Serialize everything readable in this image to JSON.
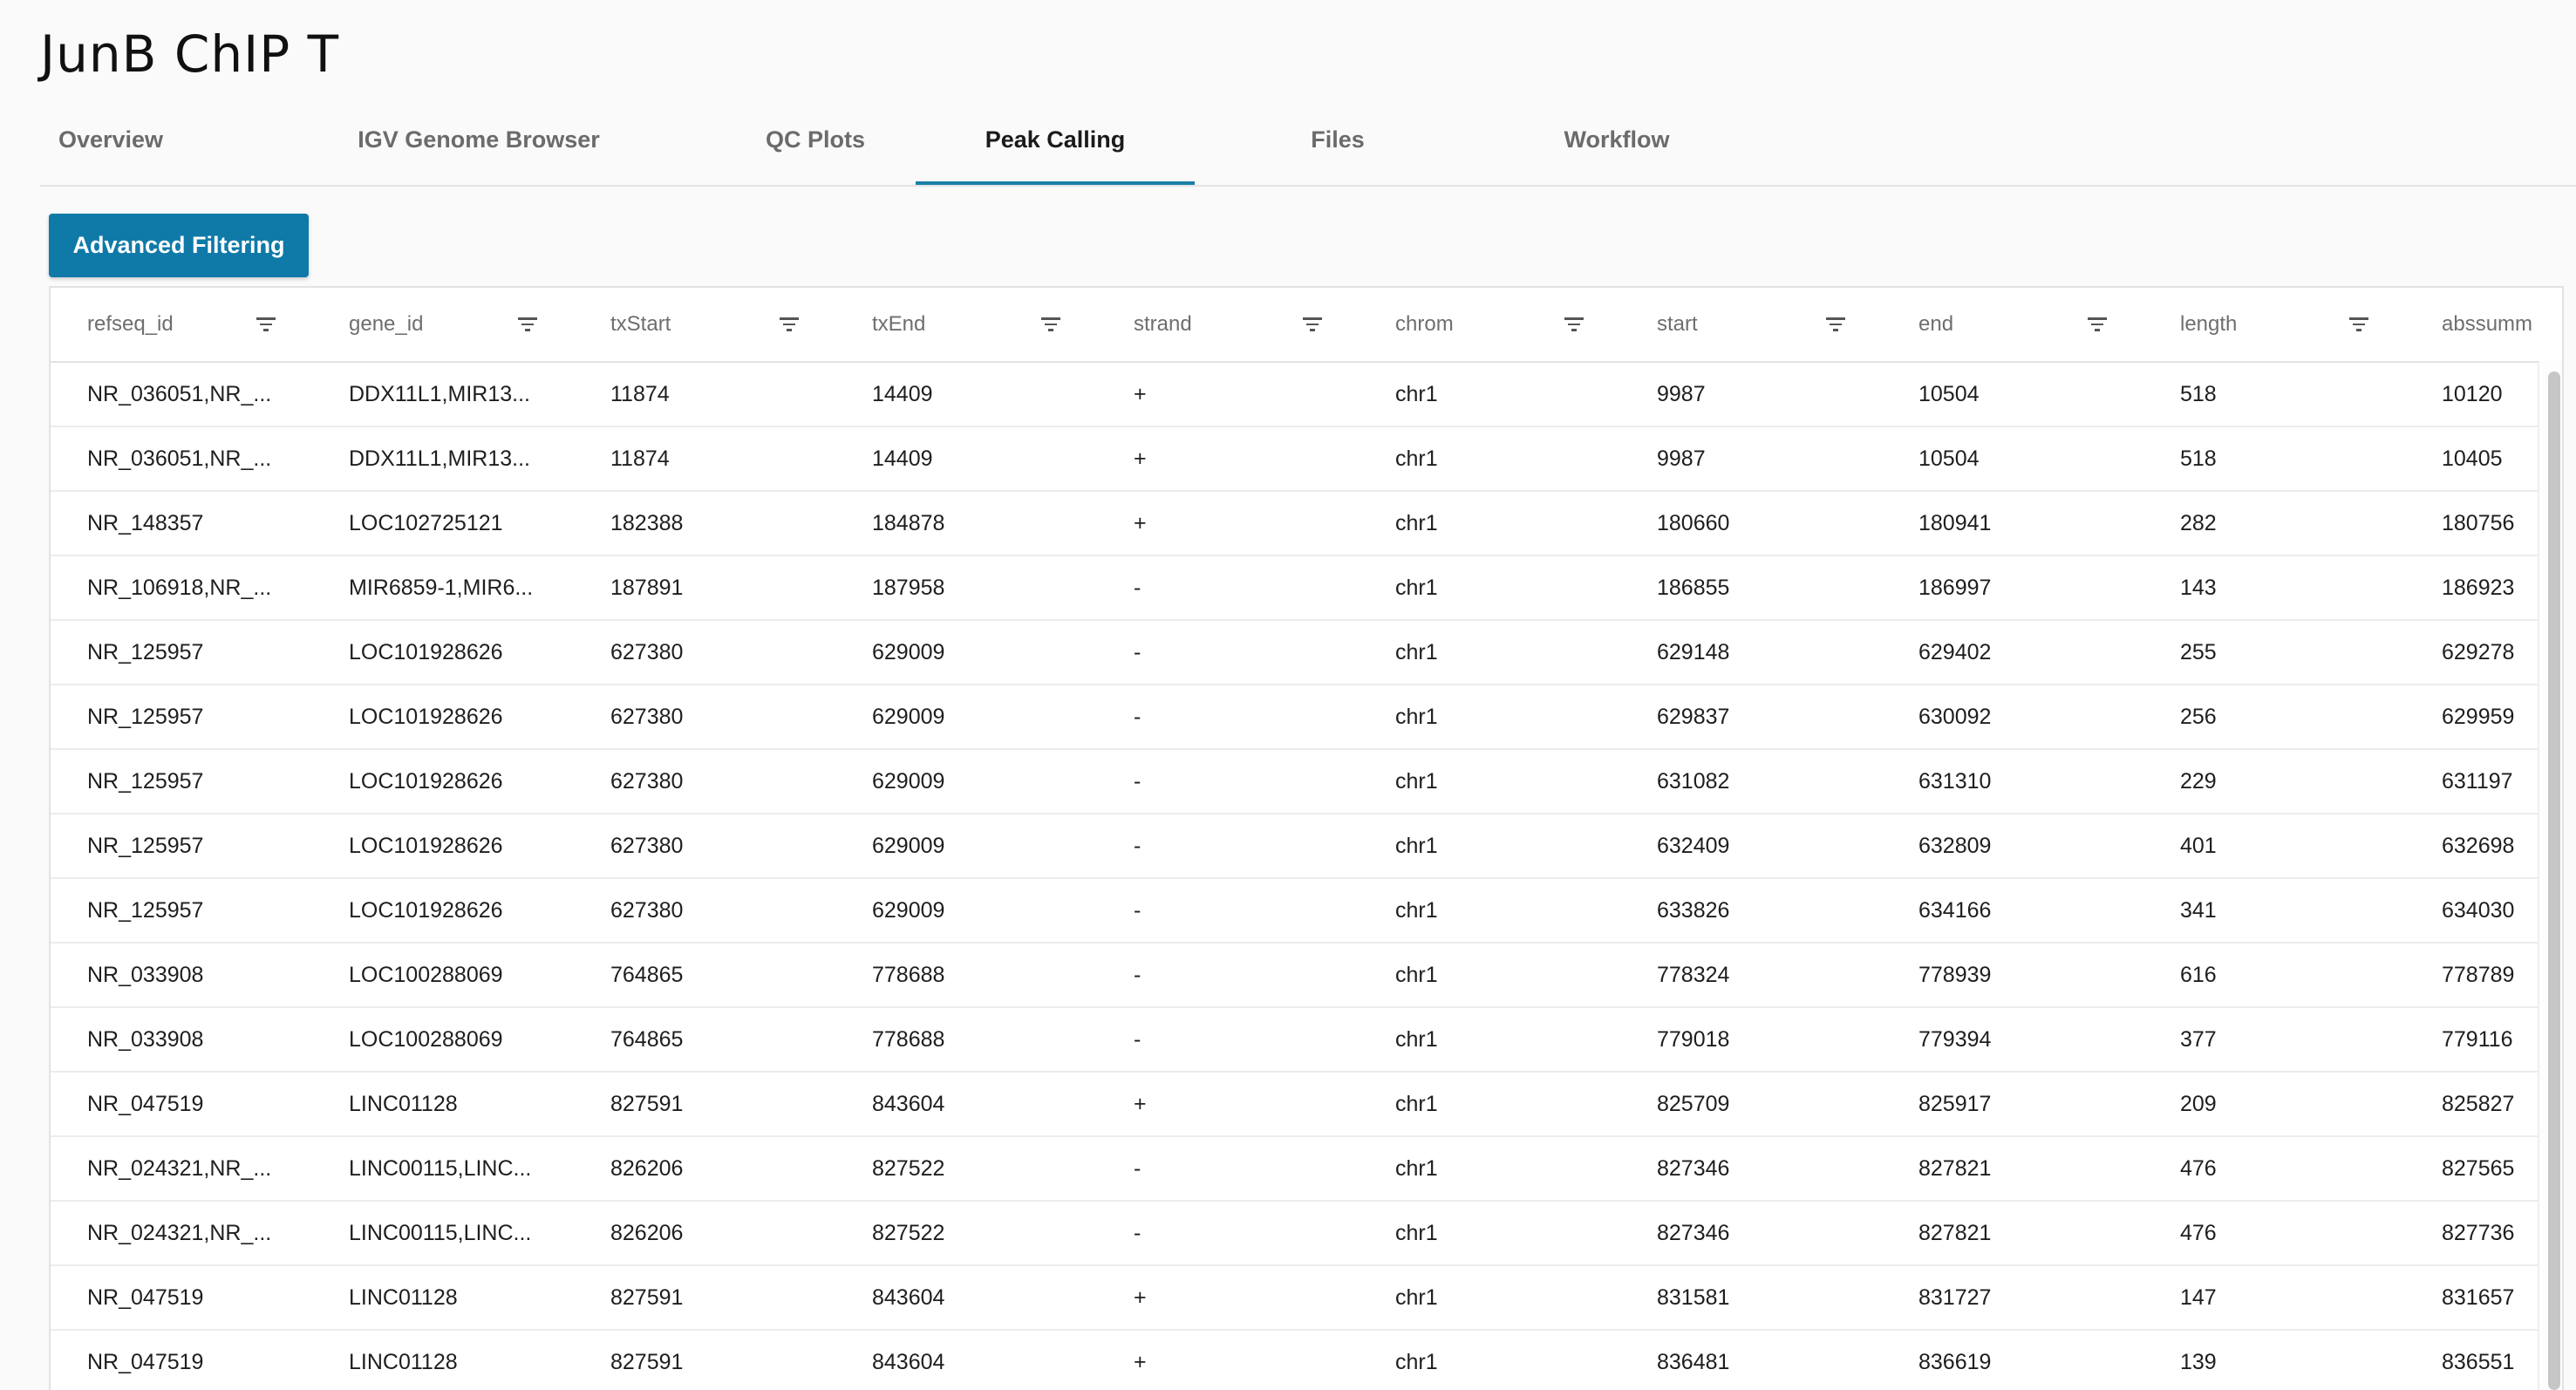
{
  "title": "JunB ChIP T",
  "tabs": [
    {
      "label": "Overview",
      "active": false
    },
    {
      "label": "IGV Genome Browser",
      "active": false
    },
    {
      "label": "QC Plots",
      "active": false
    },
    {
      "label": "Peak Calling",
      "active": true
    },
    {
      "label": "Files",
      "active": false
    },
    {
      "label": "Workflow",
      "active": false
    }
  ],
  "toolbar": {
    "advanced_filtering_label": "Advanced Filtering"
  },
  "colors": {
    "accent": "#0f7aa8",
    "active_tab_underline": "#1a7fa8"
  },
  "table": {
    "columns": [
      {
        "key": "refseq_id",
        "label": "refseq_id"
      },
      {
        "key": "gene_id",
        "label": "gene_id"
      },
      {
        "key": "txStart",
        "label": "txStart"
      },
      {
        "key": "txEnd",
        "label": "txEnd"
      },
      {
        "key": "strand",
        "label": "strand"
      },
      {
        "key": "chrom",
        "label": "chrom"
      },
      {
        "key": "start",
        "label": "start"
      },
      {
        "key": "end",
        "label": "end"
      },
      {
        "key": "length",
        "label": "length"
      },
      {
        "key": "abssummit",
        "label": "abssumm"
      }
    ],
    "rows": [
      [
        "NR_036051,NR_...",
        "DDX11L1,MIR13...",
        "11874",
        "14409",
        "+",
        "chr1",
        "9987",
        "10504",
        "518",
        "10120"
      ],
      [
        "NR_036051,NR_...",
        "DDX11L1,MIR13...",
        "11874",
        "14409",
        "+",
        "chr1",
        "9987",
        "10504",
        "518",
        "10405"
      ],
      [
        "NR_148357",
        "LOC102725121",
        "182388",
        "184878",
        "+",
        "chr1",
        "180660",
        "180941",
        "282",
        "180756"
      ],
      [
        "NR_106918,NR_...",
        "MIR6859-1,MIR6...",
        "187891",
        "187958",
        "-",
        "chr1",
        "186855",
        "186997",
        "143",
        "186923"
      ],
      [
        "NR_125957",
        "LOC101928626",
        "627380",
        "629009",
        "-",
        "chr1",
        "629148",
        "629402",
        "255",
        "629278"
      ],
      [
        "NR_125957",
        "LOC101928626",
        "627380",
        "629009",
        "-",
        "chr1",
        "629837",
        "630092",
        "256",
        "629959"
      ],
      [
        "NR_125957",
        "LOC101928626",
        "627380",
        "629009",
        "-",
        "chr1",
        "631082",
        "631310",
        "229",
        "631197"
      ],
      [
        "NR_125957",
        "LOC101928626",
        "627380",
        "629009",
        "-",
        "chr1",
        "632409",
        "632809",
        "401",
        "632698"
      ],
      [
        "NR_125957",
        "LOC101928626",
        "627380",
        "629009",
        "-",
        "chr1",
        "633826",
        "634166",
        "341",
        "634030"
      ],
      [
        "NR_033908",
        "LOC100288069",
        "764865",
        "778688",
        "-",
        "chr1",
        "778324",
        "778939",
        "616",
        "778789"
      ],
      [
        "NR_033908",
        "LOC100288069",
        "764865",
        "778688",
        "-",
        "chr1",
        "779018",
        "779394",
        "377",
        "779116"
      ],
      [
        "NR_047519",
        "LINC01128",
        "827591",
        "843604",
        "+",
        "chr1",
        "825709",
        "825917",
        "209",
        "825827"
      ],
      [
        "NR_024321,NR_...",
        "LINC00115,LINC...",
        "826206",
        "827522",
        "-",
        "chr1",
        "827346",
        "827821",
        "476",
        "827565"
      ],
      [
        "NR_024321,NR_...",
        "LINC00115,LINC...",
        "826206",
        "827522",
        "-",
        "chr1",
        "827346",
        "827821",
        "476",
        "827736"
      ],
      [
        "NR_047519",
        "LINC01128",
        "827591",
        "843604",
        "+",
        "chr1",
        "831581",
        "831727",
        "147",
        "831657"
      ],
      [
        "NR_047519",
        "LINC01128",
        "827591",
        "843604",
        "+",
        "chr1",
        "836481",
        "836619",
        "139",
        "836551"
      ]
    ]
  }
}
